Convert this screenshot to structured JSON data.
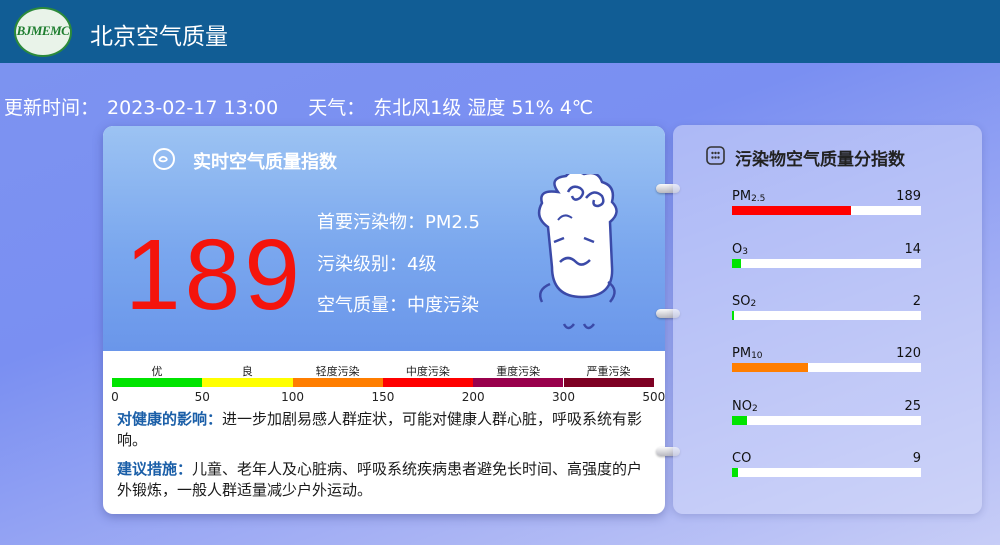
{
  "header": {
    "logo_text": "BJMEMC",
    "title": "北京空气质量"
  },
  "info": {
    "update_label": "更新时间：",
    "update_time": "2023-02-17 13:00",
    "weather_label": "天气：",
    "weather_value": "东北风1级 湿度 51% 4℃"
  },
  "realtime": {
    "title": "实时空气质量指数",
    "aqi": "189",
    "primary_pollutant": "首要污染物：PM2.5",
    "level": "污染级别：4级",
    "quality": "空气质量：中度污染"
  },
  "scale": {
    "levels": [
      "优",
      "良",
      "轻度污染",
      "中度污染",
      "重度污染",
      "严重污染"
    ],
    "ticks": [
      "0",
      "50",
      "100",
      "150",
      "200",
      "300",
      "500"
    ],
    "colors": [
      "#00e400",
      "#ffff00",
      "#ff7e00",
      "#ff0000",
      "#99004c",
      "#7e0023"
    ]
  },
  "advice": {
    "health_label": "对健康的影响：",
    "health_text": "进一步加剧易感人群症状，可能对健康人群心脏，呼吸系统有影响。",
    "measure_label": "建议措施：",
    "measure_text": "儿童、老年人及心脏病、呼吸系统疾病患者避免长时间、高强度的户外锻炼，一般人群适量减少户外运动。"
  },
  "pollutants": {
    "title": "污染物空气质量分指数",
    "items": [
      {
        "name": "PM",
        "sub": "2.5",
        "value": "189",
        "fraction": 0.63,
        "color": "#ff0000"
      },
      {
        "name": "O",
        "sub": "3",
        "value": "14",
        "fraction": 0.05,
        "color": "#00e400"
      },
      {
        "name": "SO",
        "sub": "2",
        "value": "2",
        "fraction": 0.01,
        "color": "#00e400"
      },
      {
        "name": "PM",
        "sub": "10",
        "value": "120",
        "fraction": 0.4,
        "color": "#ff7e00"
      },
      {
        "name": "NO",
        "sub": "2",
        "value": "25",
        "fraction": 0.08,
        "color": "#00e400"
      },
      {
        "name": "CO",
        "sub": "",
        "value": "9",
        "fraction": 0.03,
        "color": "#00e400"
      }
    ]
  }
}
